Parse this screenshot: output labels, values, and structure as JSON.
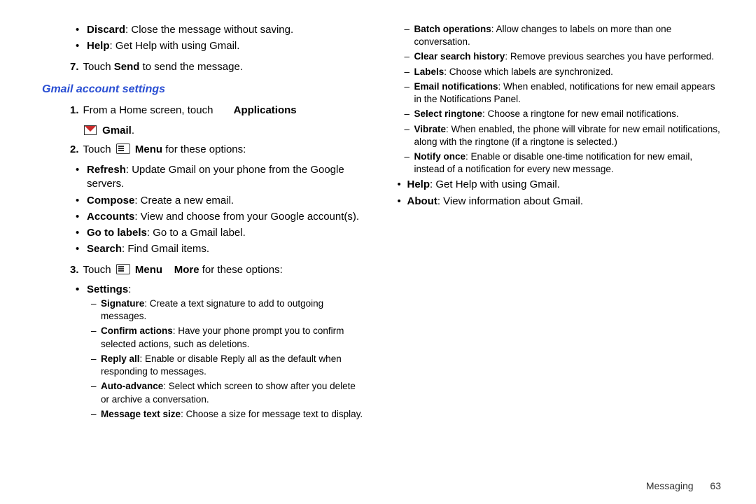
{
  "left": {
    "top_bullets": [
      {
        "b": "Discard",
        "t": ": Close the message without saving."
      },
      {
        "b": "Help",
        "t": ": Get Help with using Gmail."
      }
    ],
    "step7_num": "7.",
    "step7_a": "Touch ",
    "step7_b": "Send",
    "step7_c": " to send the message.",
    "heading": "Gmail account settings",
    "step1_num": "1.",
    "step1_a": "From a Home screen, touch",
    "step1_b": "Applications",
    "step1_gmail": "Gmail",
    "step1_gmail_dot": ".",
    "step2_num": "2.",
    "step2_a": "Touch ",
    "step2_b": "Menu",
    "step2_c": " for these options:",
    "menu_options": [
      {
        "b": "Refresh",
        "t": ": Update Gmail on your phone from the Google servers."
      },
      {
        "b": "Compose",
        "t": ": Create a new email."
      },
      {
        "b": "Accounts",
        "t": ": View and choose from your Google account(s)."
      },
      {
        "b": "Go to labels",
        "t": ": Go to a Gmail label."
      },
      {
        "b": "Search",
        "t": ": Find Gmail items."
      }
    ],
    "step3_num": "3.",
    "step3_a": "Touch ",
    "step3_b": "Menu",
    "step3_arrow": "",
    "step3_c": "More",
    "step3_d": " for these options:",
    "settings_label": "Settings",
    "settings_colon": ":",
    "settings_sub": [
      {
        "b": "Signature",
        "t": ": Create a text signature to add to outgoing messages."
      },
      {
        "b": "Confirm actions",
        "t": ": Have your phone prompt you to confirm selected actions, such as deletions."
      },
      {
        "b": "Reply all",
        "t": ": Enable or disable Reply all as the default when responding to messages."
      },
      {
        "b": "Auto-advance",
        "t": ": Select which screen to show after you delete or archive a conversation."
      },
      {
        "b": "Message text size",
        "t": ": Choose a size for message text to display."
      }
    ]
  },
  "right": {
    "settings_sub_cont": [
      {
        "b": "Batch operations",
        "t": ": Allow changes to labels on more than one conversation."
      },
      {
        "b": "Clear search history",
        "t": ": Remove previous searches you have performed."
      },
      {
        "b": "Labels",
        "t": ": Choose which labels are synchronized."
      },
      {
        "b": "Email notifications",
        "t": ": When enabled, notifications for new email appears in the Notifications Panel."
      },
      {
        "b": "Select ringtone",
        "t": ": Choose a ringtone for new email notifications."
      },
      {
        "b": "Vibrate",
        "t": ": When enabled, the phone will vibrate for new email notifications, along with the ringtone (if a ringtone is selected.)"
      },
      {
        "b": "Notify once",
        "t": ": Enable or disable one-time notification for new email, instead of a notification for every new message."
      }
    ],
    "more_bullets": [
      {
        "b": "Help",
        "t": ": Get Help with using Gmail."
      },
      {
        "b": "About",
        "t": ": View information about Gmail."
      }
    ]
  },
  "footer": {
    "section": "Messaging",
    "page": "63"
  }
}
